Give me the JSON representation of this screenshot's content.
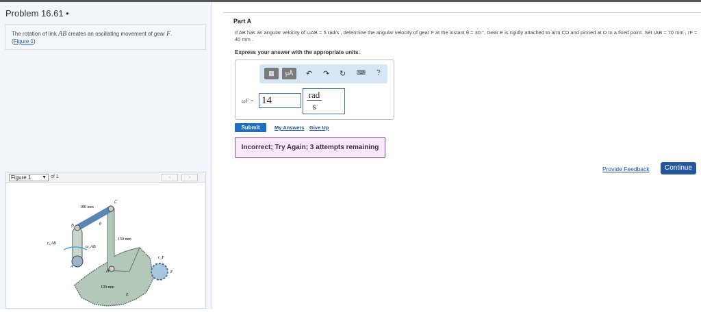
{
  "problem": {
    "title": "Problem 16.61 •",
    "intro_text_1": "The rotation of link ",
    "intro_var_1": "AB",
    "intro_text_2": " creates an oscillating movement of gear ",
    "intro_var_2": "F",
    "intro_text_3": ".",
    "figure_link": "Figure 1"
  },
  "figure": {
    "selector": "Figure 1",
    "of": "of 1",
    "prev": "‹",
    "next": "›",
    "labels": {
      "dim1": "100 mm",
      "dim2": "150 mm",
      "dim3": "100 mm",
      "A": "A",
      "B": "B",
      "C": "C",
      "D": "D",
      "E": "E",
      "F": "F",
      "theta": "θ",
      "rAB": "r_AB",
      "omega": "ω_AB",
      "rF": "r_F"
    }
  },
  "part": {
    "label": "Part A",
    "question": "If AB has an angular velocity of ωAB = 5 rad/s , determine the angular velocity of gear F at the instant θ = 30 °. Gear E is rigidly attached to arm CD and pinned at D to a fixed point. Set rAB = 70 mm , rF = 40 mm .",
    "express": "Express your answer with the appropriate units."
  },
  "answer": {
    "label": "ωF =",
    "value": "14",
    "unit_num": "rad",
    "unit_den": "s"
  },
  "toolbar": {
    "units_btn": "μÅ",
    "help": "?",
    "keyboard": "⌨"
  },
  "actions": {
    "submit": "Submit",
    "my_answers": "My Answers",
    "give_up": "Give Up"
  },
  "feedback": {
    "message": "Incorrect; Try Again; 3 attempts remaining"
  },
  "footer": {
    "provide_feedback": "Provide Feedback",
    "continue": "Continue"
  }
}
